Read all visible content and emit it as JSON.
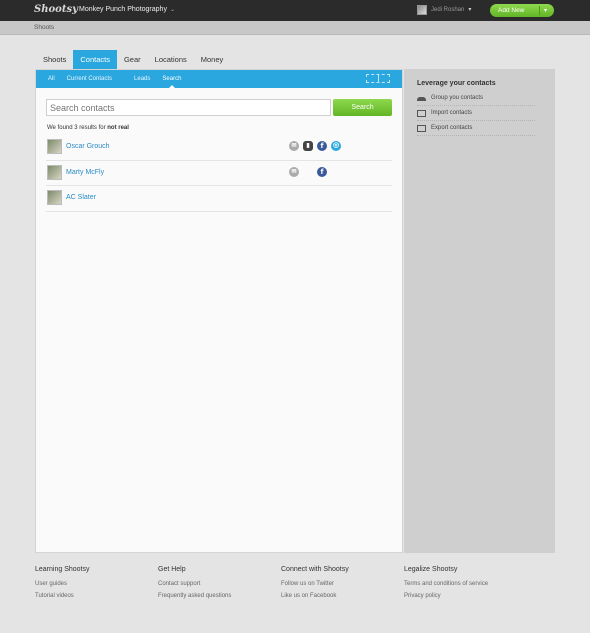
{
  "topbar": {
    "logo": "Shootsy",
    "studio": "Monkey Punch Photography",
    "user": "Jedi Roshan",
    "add_new": "Add New"
  },
  "breadcrumb": "Shoots",
  "main_tabs": [
    {
      "label": "Shoots"
    },
    {
      "label": "Contacts"
    },
    {
      "label": "Gear"
    },
    {
      "label": "Locations"
    },
    {
      "label": "Money"
    }
  ],
  "sub_tabs": [
    {
      "label": "All"
    },
    {
      "label": "Current Contacts"
    },
    {
      "label": "Leads"
    },
    {
      "label": "Search"
    }
  ],
  "search": {
    "placeholder": "Search contacts",
    "button": "Search"
  },
  "results": {
    "prefix": "We found 3 results for",
    "query": "not real"
  },
  "contacts": [
    {
      "name": "Oscar Grouch"
    },
    {
      "name": "Marty McFly"
    },
    {
      "name": "AC Slater"
    }
  ],
  "side": {
    "title": "Leverage your contacts",
    "items": [
      {
        "label": "Group you contacts",
        "icon": "group-icon"
      },
      {
        "label": "Import contacts",
        "icon": "import-icon"
      },
      {
        "label": "Export contacts",
        "icon": "export-icon"
      }
    ]
  },
  "footer": [
    {
      "heading": "Learning Shootsy",
      "links": [
        "User guides",
        "Tutorial videos"
      ]
    },
    {
      "heading": "Get Help",
      "links": [
        "Contact support",
        "Frequently asked questions"
      ]
    },
    {
      "heading": "Connect with Shootsy",
      "links": [
        "Follow us on Twitter",
        "Like us on Facebook"
      ]
    },
    {
      "heading": "Legalize Shootsy",
      "links": [
        "Terms and conditions of service",
        "Privacy policy"
      ]
    }
  ],
  "colors": {
    "accent": "#2aa7df",
    "green": "#6cc02e",
    "topbar": "#2b2b2b"
  }
}
